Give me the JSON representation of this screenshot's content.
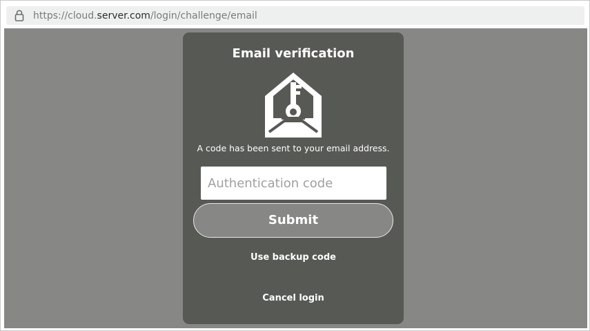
{
  "browser": {
    "url_prefix": "https://cloud.",
    "url_host": "server.com",
    "url_path": "/login/challenge/email",
    "lock_icon": "lock-icon"
  },
  "card": {
    "title": "Email verification",
    "icon": "envelope-key-icon",
    "message": "A code has been sent to your email address.",
    "code_input": {
      "value": "",
      "placeholder": "Authentication code"
    },
    "submit_label": "Submit",
    "backup_link": "Use backup code",
    "cancel_link": "Cancel login"
  },
  "colors": {
    "page_background": "#878886",
    "card_background": "#575955",
    "button_background": "#878886",
    "text": "#ffffff"
  }
}
